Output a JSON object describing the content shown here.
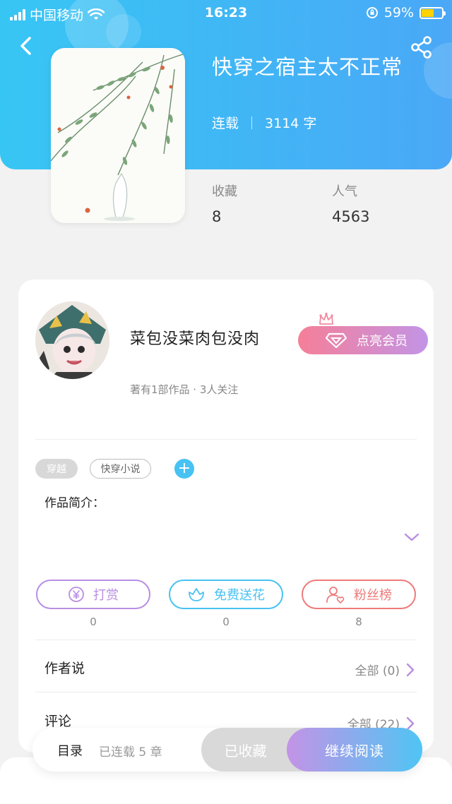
{
  "status_bar": {
    "carrier": "中国移动",
    "time": "16:23",
    "battery": "59%",
    "battery_level": 0.59
  },
  "book": {
    "title": "快穿之宿主太不正常",
    "status": "连载",
    "word_count": "3114 字"
  },
  "stats": [
    {
      "label": "收藏",
      "value": "8"
    },
    {
      "label": "人气",
      "value": "4563"
    }
  ],
  "author": {
    "name": "菜包没菜肉包没肉",
    "info": "著有1部作品 · 3人关注",
    "vip_label": "点亮会员"
  },
  "tags": [
    "穿越",
    "快穿小说"
  ],
  "intro_label": "作品简介：",
  "actions": [
    {
      "label": "打赏",
      "count": "0",
      "color": "#b98ee3",
      "icon": "yen-coin-icon"
    },
    {
      "label": "免费送花",
      "count": "0",
      "color": "#48c2f2",
      "icon": "flower-icon"
    },
    {
      "label": "粉丝榜",
      "count": "8",
      "color": "#ee7a7a",
      "icon": "fan-user-icon"
    }
  ],
  "author_says": {
    "label": "作者说",
    "all": "全部 (0)"
  },
  "comments": {
    "label": "评论",
    "all": "全部 (22)"
  },
  "bottom": {
    "toc": "目录",
    "toc_status": "已连载 5 章",
    "collected": "已收藏",
    "continue": "继续阅读"
  },
  "colors": {
    "header_start": "#37c6f4",
    "header_end": "#4aa8f6",
    "accent_purple": "#b98ee3",
    "vip_start": "#f57f98",
    "vip_end": "#c394e6"
  }
}
